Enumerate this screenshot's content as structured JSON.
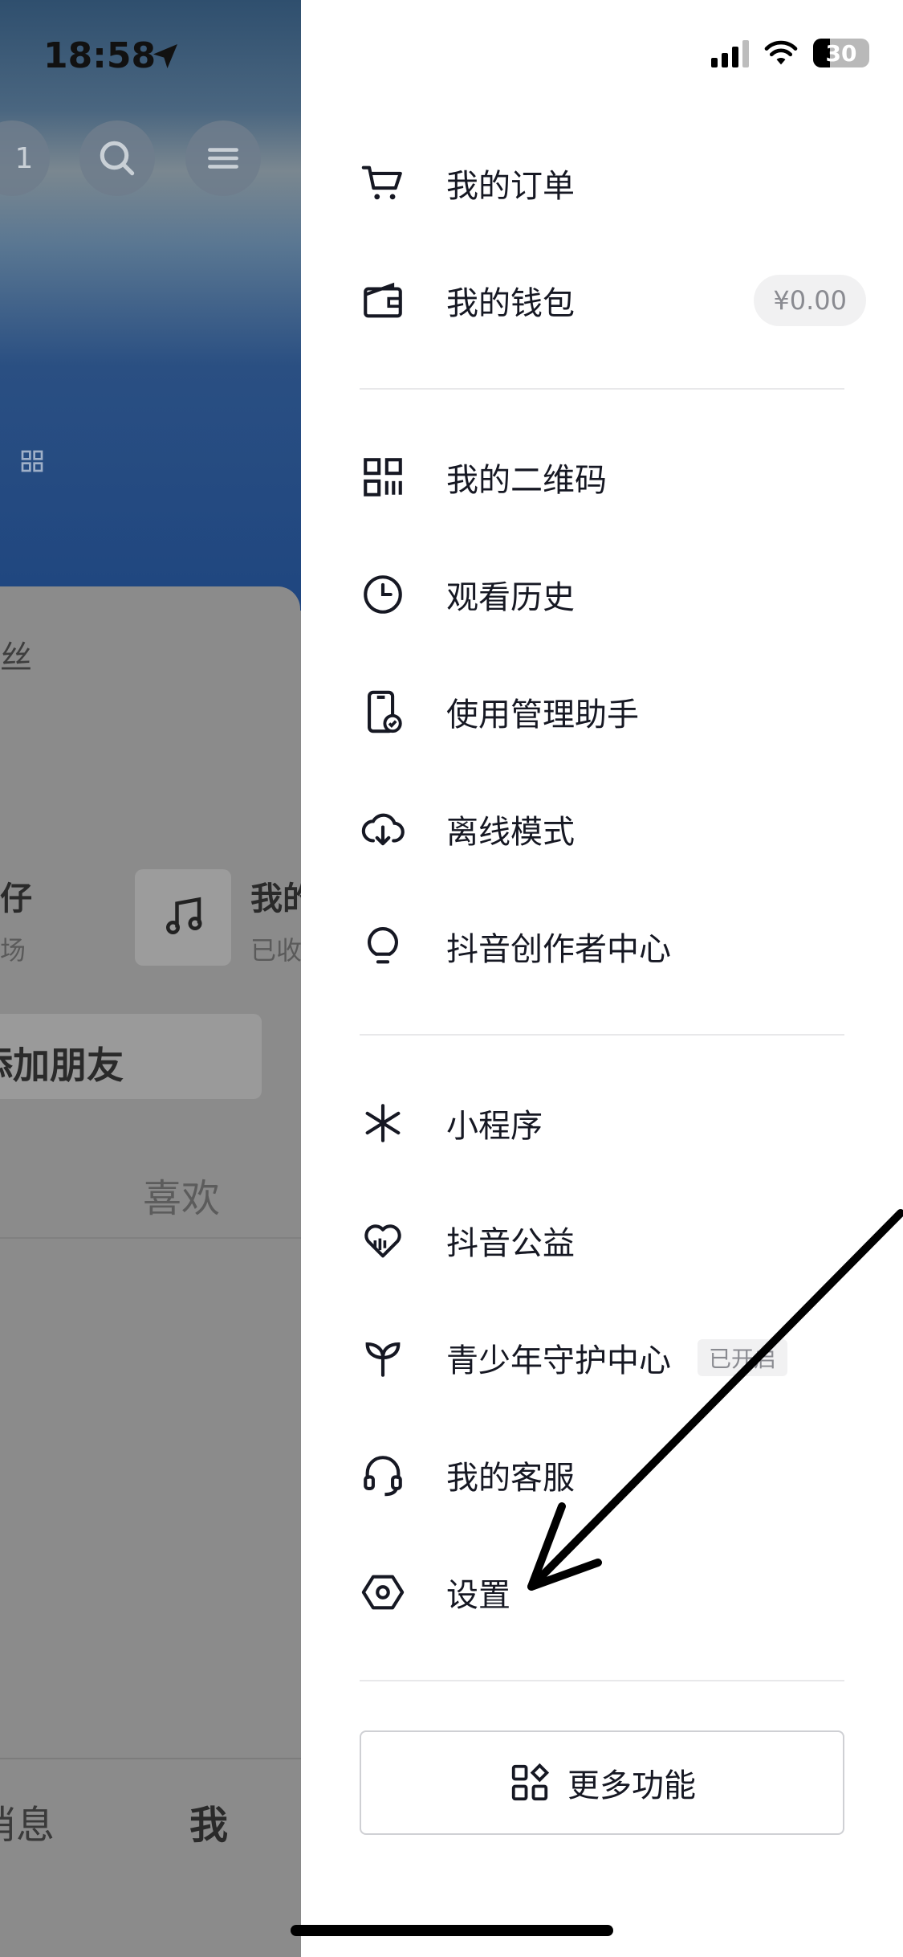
{
  "status_bar": {
    "time": "18:58",
    "battery": "30"
  },
  "background_page": {
    "badge_count": "1",
    "follower_label": "粉丝",
    "friend_label": "子仔",
    "friend_sub": "广场",
    "music_title": "我的",
    "music_sub": "已收",
    "add_friend": "添加朋友",
    "tab_likes": "喜欢",
    "nav_messages": "消息",
    "nav_me": "我"
  },
  "drawer": {
    "group1": [
      {
        "icon": "cart-icon",
        "label": "我的订单"
      },
      {
        "icon": "wallet-icon",
        "label": "我的钱包",
        "badge": "¥0.00"
      }
    ],
    "group2": [
      {
        "icon": "qrcode-icon",
        "label": "我的二维码"
      },
      {
        "icon": "clock-icon",
        "label": "观看历史"
      },
      {
        "icon": "phone-check-icon",
        "label": "使用管理助手"
      },
      {
        "icon": "cloud-download-icon",
        "label": "离线模式"
      },
      {
        "icon": "lightbulb-icon",
        "label": "抖音创作者中心"
      }
    ],
    "group3": [
      {
        "icon": "mini-program-icon",
        "label": "小程序"
      },
      {
        "icon": "heart-charity-icon",
        "label": "抖音公益"
      },
      {
        "icon": "sprout-icon",
        "label": "青少年守护中心",
        "tag": "已开启"
      },
      {
        "icon": "headset-icon",
        "label": "我的客服"
      },
      {
        "icon": "hexagon-settings-icon",
        "label": "设置"
      }
    ],
    "more_button": "更多功能"
  }
}
